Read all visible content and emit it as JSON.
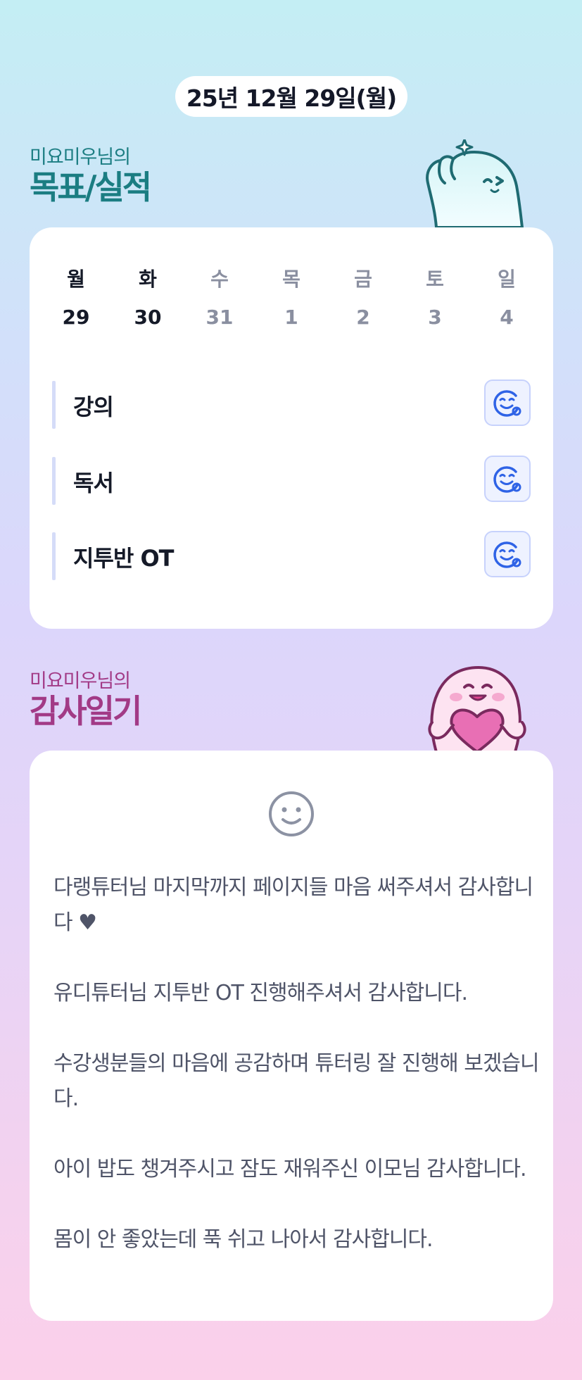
{
  "date_label": "25년 12월 29일(월)",
  "goal_section": {
    "subtitle": "미요미우님의",
    "title": "목표/실적"
  },
  "week": {
    "days": [
      {
        "name": "월",
        "num": "29",
        "selected": true,
        "bold": true
      },
      {
        "name": "화",
        "num": "30",
        "selected": false,
        "bold": true
      },
      {
        "name": "수",
        "num": "31",
        "selected": false,
        "bold": false
      },
      {
        "name": "목",
        "num": "1",
        "selected": false,
        "bold": false
      },
      {
        "name": "금",
        "num": "2",
        "selected": false,
        "bold": false
      },
      {
        "name": "토",
        "num": "3",
        "selected": false,
        "bold": false
      },
      {
        "name": "일",
        "num": "4",
        "selected": false,
        "bold": false
      }
    ]
  },
  "goals": [
    {
      "label": "강의",
      "icon": "smile-add-icon"
    },
    {
      "label": "독서",
      "icon": "smile-add-icon"
    },
    {
      "label": "지투반 OT",
      "icon": "smile-add-icon"
    }
  ],
  "gratitude_section": {
    "subtitle": "미요미우님의",
    "title": "감사일기",
    "icon": "smile-face-icon",
    "entries": [
      "다랭튜터님 마지막까지 페이지들 마음 써주셔서 감사합니다 ♥",
      "유디튜터님 지투반 OT 진행해주셔서 감사합니다.",
      "수강생분들의 마음에 공감하며 튜터링 잘 진행해 보겠습니다.",
      "아이 밥도 챙겨주시고 잠도 재워주신 이모님 감사합니다.",
      "몸이 안 좋았는데 푹 쉬고 나아서 감사합니다."
    ]
  },
  "colors": {
    "goal_accent": "#1b7d82",
    "gratitude_accent": "#a23a86",
    "selected_day": "#c2eef2",
    "icon_blue": "#2f63e6"
  }
}
